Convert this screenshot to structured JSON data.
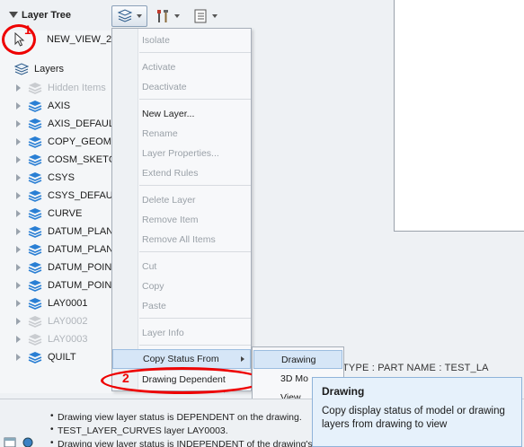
{
  "layer_tree": {
    "title": "Layer Tree",
    "view_name": "NEW_VIEW_2",
    "root_label": "Layers",
    "items": [
      {
        "label": "Hidden Items",
        "dim": true
      },
      {
        "label": "AXIS",
        "dim": false
      },
      {
        "label": "AXIS_DEFAUL",
        "dim": false
      },
      {
        "label": "COPY_GEOM",
        "dim": false
      },
      {
        "label": "COSM_SKETC",
        "dim": false
      },
      {
        "label": "CSYS",
        "dim": false
      },
      {
        "label": "CSYS_DEFAU",
        "dim": false
      },
      {
        "label": "CURVE",
        "dim": false
      },
      {
        "label": "DATUM_PLAN",
        "dim": false
      },
      {
        "label": "DATUM_PLAN",
        "dim": false
      },
      {
        "label": "DATUM_POINT",
        "dim": false
      },
      {
        "label": "DATUM_POINT",
        "dim": false
      },
      {
        "label": "LAY0001",
        "dim": false
      },
      {
        "label": "LAY0002",
        "dim": true
      },
      {
        "label": "LAY0003",
        "dim": true
      },
      {
        "label": "QUILT",
        "dim": false
      }
    ]
  },
  "annotations": {
    "marker1": "1",
    "marker2": "2"
  },
  "context_menu": {
    "isolate": "Isolate",
    "activate": "Activate",
    "deactivate": "Deactivate",
    "new_layer": "New Layer...",
    "rename": "Rename",
    "layer_properties": "Layer Properties...",
    "extend_rules": "Extend Rules",
    "delete_layer": "Delete Layer",
    "remove_item": "Remove Item",
    "remove_all_items": "Remove All Items",
    "cut": "Cut",
    "copy": "Copy",
    "paste": "Paste",
    "layer_info": "Layer Info",
    "copy_status_from": "Copy Status From",
    "drawing_dependent": "Drawing Dependent"
  },
  "submenu": {
    "drawing": "Drawing",
    "model_3d": "3D Mo",
    "view": "View"
  },
  "tooltip": {
    "title": "Drawing",
    "body": "Copy display status of model or drawing layers from drawing to view"
  },
  "canvas": {
    "type_text": "TYPE : PART     NAME : TEST_LA"
  },
  "messages": [
    "Drawing view layer status is DEPENDENT on the drawing.",
    "TEST_LAYER_CURVES layer LAY0003.",
    "Drawing view layer status is INDEPENDENT of the drawing's layer status."
  ],
  "colors": {
    "accent_red": "#e00000",
    "highlight": "#d6e6f7",
    "layer_icon": "#2a7fd4"
  }
}
